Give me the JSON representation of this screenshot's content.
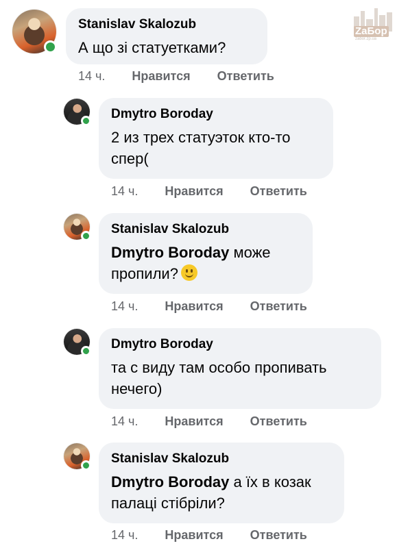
{
  "watermark": {
    "brand": "ZaБор",
    "site": "zabor.zp.ua"
  },
  "comments": [
    {
      "author": "Stanislav Skalozub",
      "mention": "",
      "text": "А що зі статуетками?",
      "time": "14 ч.",
      "like": "Нравится",
      "reply": "Ответить"
    },
    {
      "author": "Dmytro Boroday",
      "mention": "",
      "text": "2 из трех статуэток кто-то спер(",
      "time": "14 ч.",
      "like": "Нравится",
      "reply": "Ответить"
    },
    {
      "author": "Stanislav Skalozub",
      "mention": "Dmytro Boroday",
      "text": " може пропили?",
      "emoji": "slightly-smiling-face",
      "time": "14 ч.",
      "like": "Нравится",
      "reply": "Ответить"
    },
    {
      "author": "Dmytro Boroday",
      "mention": "",
      "text": "та с виду там особо пропивать нечего)",
      "time": "14 ч.",
      "like": "Нравится",
      "reply": "Ответить"
    },
    {
      "author": "Stanislav Skalozub",
      "mention": "Dmytro Boroday",
      "text": " а їх в козак палаці стібріли?",
      "time": "14 ч.",
      "like": "Нравится",
      "reply": "Ответить"
    }
  ],
  "colors": {
    "bubble": "#f0f2f5",
    "online": "#31a24c",
    "meta_text": "#65676b"
  }
}
